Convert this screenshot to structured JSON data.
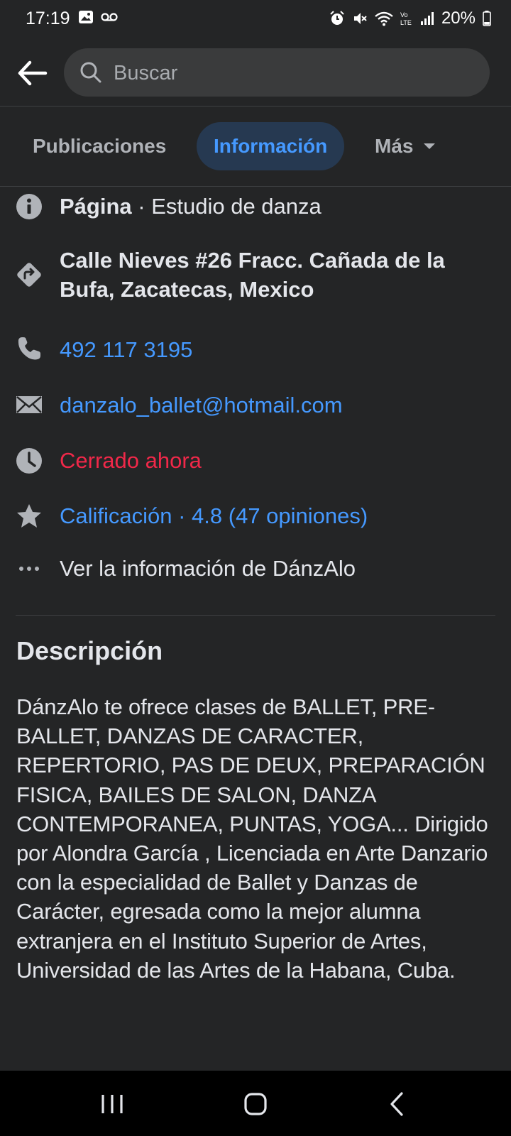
{
  "status_bar": {
    "time": "17:19",
    "battery": "20%",
    "icons_left": [
      "image-icon",
      "voicemail-icon"
    ],
    "icons_right": [
      "alarm-icon",
      "mute-icon",
      "wifi-icon",
      "volte-icon",
      "signal-icon",
      "battery-icon"
    ]
  },
  "search": {
    "placeholder": "Buscar"
  },
  "tabs": [
    {
      "label": "Publicaciones",
      "active": false
    },
    {
      "label": "Información",
      "active": true
    },
    {
      "label": "Más",
      "active": false
    }
  ],
  "info": {
    "category_label": "Página",
    "category_value": " · Estudio de danza",
    "address": "Calle Nieves #26 Fracc. Cañada de la Bufa, Zacatecas, Mexico",
    "phone": "492 117 3195",
    "email": "danzalo_ballet@hotmail.com",
    "hours_status": "Cerrado ahora",
    "rating": "Calificación · 4.8 (47 opiniones)",
    "see_more": "Ver la información de DánzAlo"
  },
  "description": {
    "title": "Descripción",
    "text": "DánzAlo te ofrece clases de BALLET, PRE-BALLET, DANZAS DE CARACTER, REPERTORIO, PAS DE DEUX, PREPARACIÓN FISICA, BAILES DE SALON, DANZA CONTEMPORANEA, PUNTAS, YOGA... Dirigido por Alondra García , Licenciada en Arte Danzario con la especialidad de Ballet y Danzas de Carácter, egresada como la mejor alumna extranjera en el Instituto Superior de Artes, Universidad de las Artes de la Habana, Cuba."
  },
  "colors": {
    "background": "#242526",
    "link": "#4599ff",
    "active_tab_bg": "#263951",
    "closed_red": "#f02849"
  }
}
